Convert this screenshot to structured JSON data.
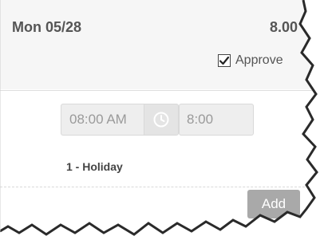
{
  "day": {
    "date": "Mon 05/28",
    "hours": "8.00",
    "approve_label": "Approve",
    "approve_checked": true
  },
  "entry": {
    "start_time": "08:00 AM",
    "duration": "8:00",
    "pay_code": "1 - Holiday",
    "add_label": "Add"
  },
  "icons": {
    "clock": "clock-icon",
    "check": "check-icon"
  },
  "colors": {
    "header_bg": "#f6f6f6",
    "input_bg": "#eeeeee",
    "button_bg": "#a9a9a9"
  }
}
